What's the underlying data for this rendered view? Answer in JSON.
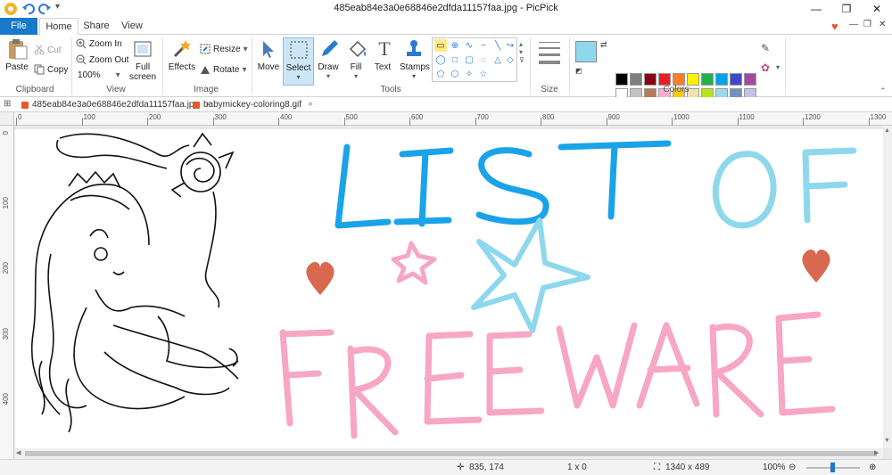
{
  "window": {
    "title": "485eab84e3a0e68846e2dfda11157faa.jpg - PicPick",
    "min_label": "—",
    "max_label": "❐",
    "close_label": "✕"
  },
  "ribbon_tabs": {
    "file": "File",
    "home": "Home",
    "share": "Share",
    "view": "View"
  },
  "clipboard": {
    "paste": "Paste",
    "cut": "Cut",
    "copy": "Copy",
    "group": "Clipboard"
  },
  "view_group": {
    "zoom_in": "Zoom In",
    "zoom_out": "Zoom Out",
    "zoom_value": "100%",
    "full_screen_1": "Full",
    "full_screen_2": "screen",
    "group": "View"
  },
  "image_group": {
    "effects": "Effects",
    "resize": "Resize",
    "rotate": "Rotate",
    "group": "Image"
  },
  "tools_group": {
    "move": "Move",
    "select": "Select",
    "draw": "Draw",
    "fill": "Fill",
    "text": "Text",
    "stamps": "Stamps",
    "group": "Tools"
  },
  "size_group": {
    "group": "Size"
  },
  "colors_group": {
    "group": "Colors",
    "primary": "#8ed8ee",
    "secondary": "#ffffff",
    "row1": [
      "#000000",
      "#7f7f7f",
      "#880015",
      "#ed1c24",
      "#ff7f27",
      "#fff200",
      "#22b14c",
      "#00a2e8",
      "#3f48cc",
      "#a349a4"
    ],
    "row2": [
      "#ffffff",
      "#c3c3c3",
      "#b97a57",
      "#ffaec9",
      "#ffc90e",
      "#efe4b0",
      "#b5e61d",
      "#99d9ea",
      "#7092be",
      "#c8bfe7"
    ],
    "row3": [
      "#ffffff",
      "#ffffff",
      "#ffffff",
      "#ffffff",
      "#ffffff",
      "#ffffff",
      "#ffffff",
      "#ffffff",
      "#ffffff",
      "#ffffff"
    ]
  },
  "doc_tabs": [
    {
      "name": "485eab84e3a0e68846e2dfda11157faa.jpg",
      "close": "×"
    },
    {
      "name": "babymickey-coloring8.gif",
      "close": "×"
    }
  ],
  "ruler": {
    "h_labels": [
      "0",
      "100",
      "200",
      "300",
      "400",
      "500",
      "600",
      "700",
      "800",
      "900",
      "1000",
      "1100",
      "1200",
      "1300"
    ],
    "v_labels": [
      "0",
      "100",
      "200",
      "300",
      "400"
    ]
  },
  "canvas": {
    "line1": "LIST OF",
    "line2": "FREEWARE",
    "line1_color": "#1aa3e8",
    "line1b_color": "#8ed8ee",
    "line2_color": "#f7a6c5",
    "heart_color": "#d9694e"
  },
  "status": {
    "cursor": "835, 174",
    "selection": "1 x 0",
    "image_size": "1340 x 489",
    "zoom": "100%"
  },
  "icons": {
    "app": "picpick-logo-icon",
    "undo": "undo-icon",
    "redo": "redo-icon",
    "heart": "heart-icon"
  }
}
